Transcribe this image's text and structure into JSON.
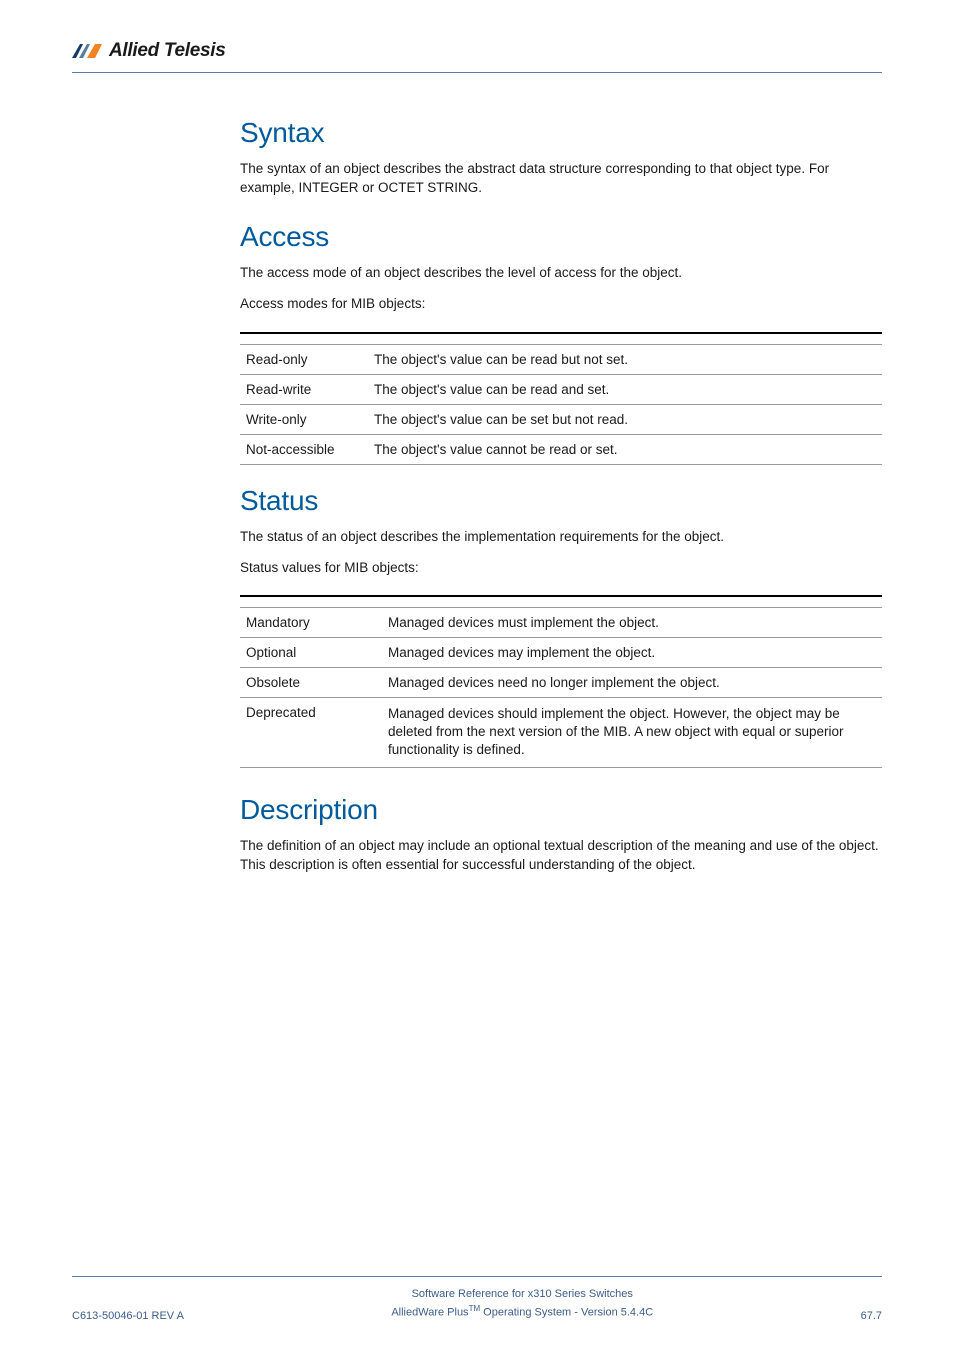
{
  "logo": {
    "brand": "Allied Telesis"
  },
  "sections": {
    "syntax": {
      "heading": "Syntax",
      "body": "The syntax of an object describes the abstract data structure corresponding to that object type. For example, INTEGER or OCTET STRING."
    },
    "access": {
      "heading": "Access",
      "intro": "The access mode of an object describes the level of access for the object.",
      "caption": "Access modes for MIB objects:",
      "rows": [
        {
          "mode": "Read-only",
          "desc": "The object's value can be read but not set."
        },
        {
          "mode": "Read-write",
          "desc": "The object's value can be read and set."
        },
        {
          "mode": "Write-only",
          "desc": "The object's value can be set but not read."
        },
        {
          "mode": "Not-accessible",
          "desc": "The object's value cannot be read or set."
        }
      ]
    },
    "status": {
      "heading": "Status",
      "intro": "The status of an object describes the implementation requirements for the object.",
      "caption": "Status values for MIB objects:",
      "rows": [
        {
          "val": "Mandatory",
          "desc": "Managed devices must implement the object."
        },
        {
          "val": "Optional",
          "desc": "Managed devices may implement the object."
        },
        {
          "val": "Obsolete",
          "desc": "Managed devices need no longer implement the object."
        },
        {
          "val": "Deprecated",
          "desc": "Managed devices should implement the object. However, the object may be deleted from the next version of the MIB. A new object with equal or superior functionality is defined."
        }
      ]
    },
    "description": {
      "heading": "Description",
      "body": "The definition of an object may include an optional textual description of the meaning and use of the object. This description is often essential for successful understanding of the object."
    }
  },
  "footer": {
    "left": "C613-50046-01 REV A",
    "line1": "Software Reference for x310 Series Switches",
    "line2_a": "AlliedWare Plus",
    "line2_tm": "TM",
    "line2_b": " Operating System - Version 5.4.4C",
    "right": "67.7"
  }
}
